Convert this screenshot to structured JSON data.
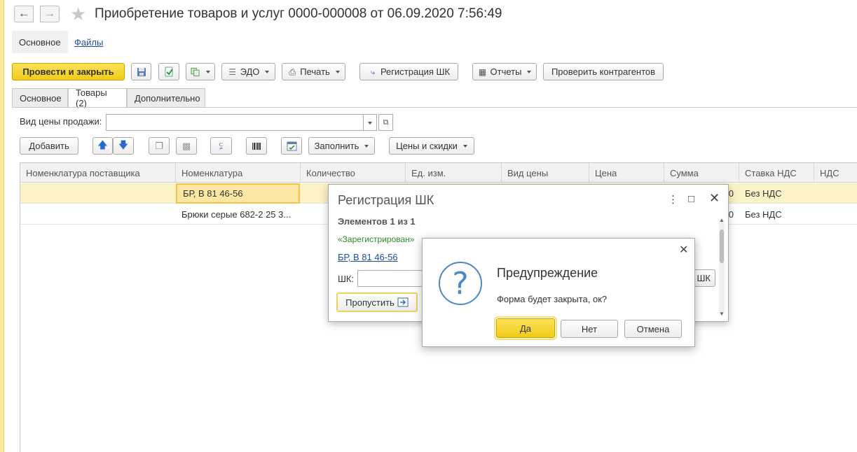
{
  "window": {
    "title": "Приобретение товаров и услуг 0000-000008 от 06.09.2020 7:56:49"
  },
  "form_tabs": [
    {
      "label": "Основное"
    },
    {
      "label": "Файлы"
    }
  ],
  "toolbar": {
    "post_close": "Провести и закрыть",
    "edo": "ЭДО",
    "print": "Печать",
    "register_shk": "Регистрация ШК",
    "reports": "Отчеты",
    "check_contractors": "Проверить контрагентов"
  },
  "page_tabs": [
    {
      "label": "Основное"
    },
    {
      "label": "Товары (2)"
    },
    {
      "label": "Дополнительно"
    }
  ],
  "price_field": {
    "label": "Вид цены продажи:",
    "value": ""
  },
  "table_toolbar": {
    "add": "Добавить",
    "fill": "Заполнить",
    "prices": "Цены и скидки"
  },
  "table": {
    "columns": [
      "Номенклатура поставщика",
      "Номенклатура",
      "Количество",
      "Ед. изм.",
      "Вид цены",
      "Цена",
      "Сумма",
      "Ставка НДС",
      "НДС"
    ],
    "rows": [
      {
        "supplier_item": "",
        "item": "БР, В 81 46-56",
        "sum_tail": "0",
        "vat_rate": "Без НДС"
      },
      {
        "supplier_item": "",
        "item": "Брюки серые 682-2 25 3...",
        "sum_tail": "0",
        "vat_rate": "Без НДС"
      }
    ]
  },
  "shk_dialog": {
    "title": "Регистрация ШК",
    "count": "Элементов 1 из 1",
    "status": "«Зарегистрирован»",
    "item_link": "БР, В 81 46-56",
    "shk_label": "ШК:",
    "shk_value": "",
    "skip_button": "Пропустить",
    "right_button_tail": "ШК"
  },
  "warning_dialog": {
    "title": "Предупреждение",
    "message": "Форма будет закрыта, ок?",
    "yes": "Да",
    "no": "Нет",
    "cancel": "Отмена"
  }
}
